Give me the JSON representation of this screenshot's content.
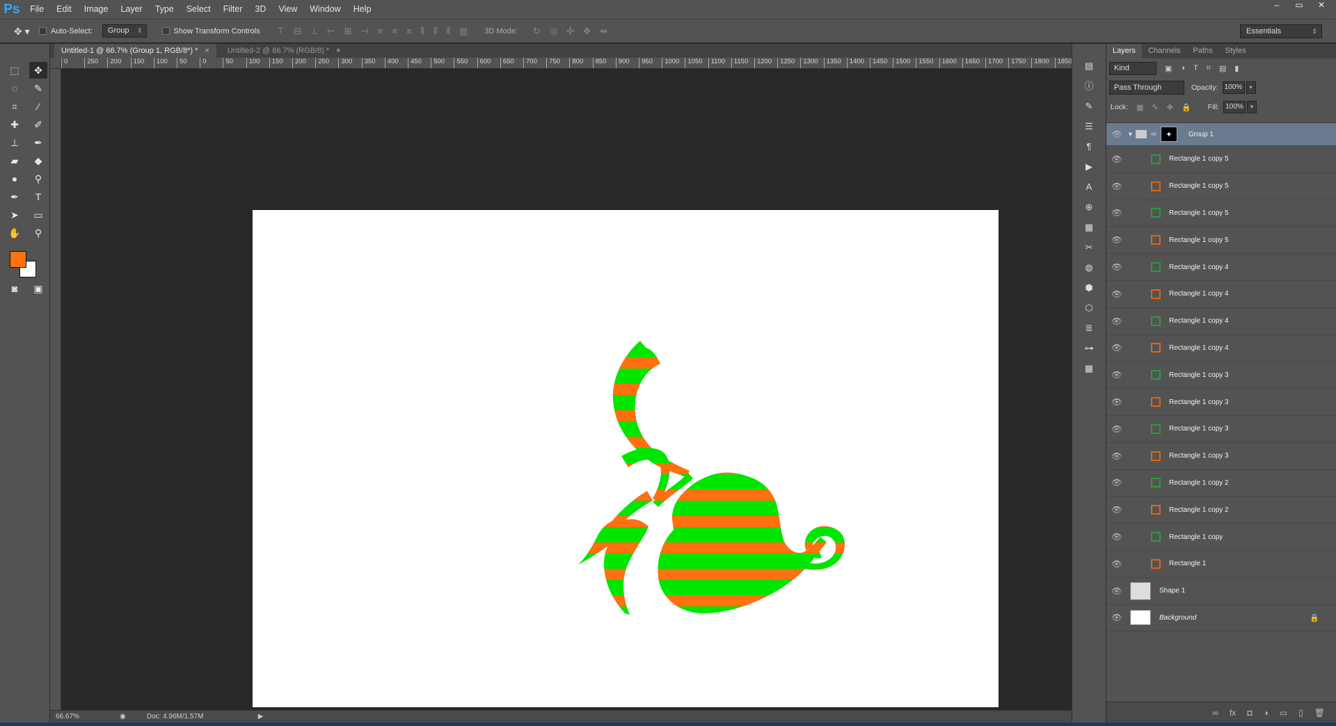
{
  "app": {
    "logo": "Ps"
  },
  "menu": [
    "File",
    "Edit",
    "Image",
    "Layer",
    "Type",
    "Select",
    "Filter",
    "3D",
    "View",
    "Window",
    "Help"
  ],
  "window_buttons": [
    "–",
    "▭",
    "✕"
  ],
  "options": {
    "tool_icon": "move-tool",
    "auto_select_label": "Auto-Select:",
    "auto_select_value": "Group",
    "show_transform_label": "Show Transform Controls",
    "mode_label": "3D Mode:",
    "workspace": "Essentials"
  },
  "tabs": [
    {
      "label": "Untitled-1 @ 66.7% (Group 1, RGB/8*) *",
      "active": true
    },
    {
      "label": "Untitled-2 @ 66.7% (RGB/8) *",
      "active": false
    }
  ],
  "ruler_ticks": [
    "0",
    "250",
    "200",
    "150",
    "100",
    "50",
    "0",
    "50",
    "100",
    "150",
    "200",
    "250",
    "300",
    "350",
    "400",
    "450",
    "500",
    "550",
    "600",
    "650",
    "700",
    "750",
    "800",
    "850",
    "900",
    "950",
    "1000",
    "1050",
    "1100",
    "1150",
    "1200",
    "1250",
    "1300",
    "1350",
    "1400",
    "1450",
    "1500",
    "1550",
    "1600",
    "1650",
    "1700",
    "1750",
    "1800",
    "1850"
  ],
  "colors": {
    "foreground": "#ff7010",
    "background": "#ffffff",
    "stripe_orange": "#ff7010",
    "stripe_green": "#00e600"
  },
  "status": {
    "zoom": "66.67%",
    "doc": "Doc: 4.96M/1.57M"
  },
  "layers_panel": {
    "tabs": [
      "Layers",
      "Channels",
      "Paths",
      "Styles"
    ],
    "kind": "Kind",
    "blend_mode": "Pass Through",
    "opacity_label": "Opacity:",
    "opacity_value": "100%",
    "lock_label": "Lock:",
    "fill_label": "Fill:",
    "fill_value": "100%",
    "group_name": "Group 1",
    "layers": [
      "Rectangle 1 copy 5",
      "Rectangle 1 copy 5",
      "Rectangle 1 copy 5",
      "Rectangle 1 copy 5",
      "Rectangle 1 copy 4",
      "Rectangle 1 copy 4",
      "Rectangle 1 copy 4",
      "Rectangle 1 copy 4",
      "Rectangle 1 copy 3",
      "Rectangle 1 copy 3",
      "Rectangle 1 copy 3",
      "Rectangle 1 copy 3",
      "Rectangle 1 copy 2",
      "Rectangle 1 copy 2",
      "Rectangle 1 copy",
      "Rectangle 1"
    ],
    "shape_layer": "Shape 1",
    "background_layer": "Background"
  }
}
